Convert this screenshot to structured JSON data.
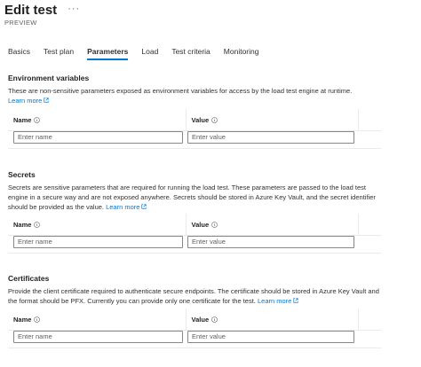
{
  "header": {
    "title": "Edit test",
    "more": "···",
    "subtitle": "PREVIEW"
  },
  "tabs": [
    {
      "label": "Basics",
      "active": false
    },
    {
      "label": "Test plan",
      "active": false
    },
    {
      "label": "Parameters",
      "active": true
    },
    {
      "label": "Load",
      "active": false
    },
    {
      "label": "Test criteria",
      "active": false
    },
    {
      "label": "Monitoring",
      "active": false
    }
  ],
  "environment": {
    "title": "Environment variables",
    "description": "These are non-sensitive parameters exposed as environment variables for access by the load test engine at runtime.",
    "learn_more": "Learn more",
    "col_name": "Name",
    "col_value": "Value",
    "name_placeholder": "Enter name",
    "value_placeholder": "Enter value"
  },
  "secrets": {
    "title": "Secrets",
    "description": "Secrets are sensitive parameters that are required for running the load test. These parameters are passed to the load test engine in a secure way and are not exposed anywhere. Secrets should be stored in Azure Key Vault, and the secret identifier should be provided as the value.",
    "learn_more": "Learn more",
    "col_name": "Name",
    "col_value": "Value",
    "name_placeholder": "Enter name",
    "value_placeholder": "Enter value"
  },
  "certificates": {
    "title": "Certificates",
    "description": "Provide the client certificate required to authenticate secure endpoints. The certificate should be stored in Azure Key Vault and the format should be PFX. Currently you can provide only one certificate for the test.",
    "learn_more": "Learn more",
    "col_name": "Name",
    "col_value": "Value",
    "name_placeholder": "Enter name",
    "value_placeholder": "Enter value"
  },
  "colors": {
    "accent": "#0078d4",
    "text": "#323130",
    "border": "#8a8886",
    "divider": "#edebe9"
  }
}
